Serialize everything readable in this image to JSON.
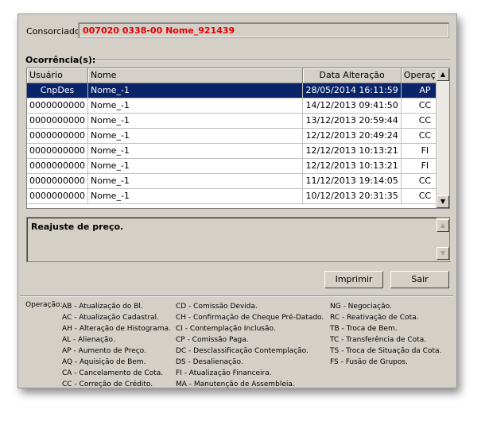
{
  "consorciado": {
    "label": "Consorciado:",
    "value": "007020 0338-00 Nome_921439"
  },
  "ocorrencias": {
    "title": "Ocorrência(s):"
  },
  "grid": {
    "headers": [
      "Usuário",
      "Nome",
      "Data Alteração",
      "Operação"
    ],
    "rows": [
      [
        "CnpDes",
        "Nome_-1",
        "28/05/2014 16:11:59",
        "AP"
      ],
      [
        "0000000000",
        "Nome_-1",
        "14/12/2013 09:41:50",
        "CC"
      ],
      [
        "0000000000",
        "Nome_-1",
        "13/12/2013 20:59:44",
        "CC"
      ],
      [
        "0000000000",
        "Nome_-1",
        "12/12/2013 20:49:24",
        "CC"
      ],
      [
        "0000000000",
        "Nome_-1",
        "12/12/2013 10:13:21",
        "FI"
      ],
      [
        "0000000000",
        "Nome_-1",
        "12/12/2013 10:13:21",
        "FI"
      ],
      [
        "0000000000",
        "Nome_-1",
        "11/12/2013 19:14:05",
        "CC"
      ],
      [
        "0000000000",
        "Nome_-1",
        "10/12/2013 20:31:35",
        "CC"
      ]
    ],
    "selected_row": 0
  },
  "memo": {
    "text": "Reajuste de preço."
  },
  "buttons": {
    "print": "Imprimir",
    "exit": "Sair"
  },
  "legend": {
    "label": "Operação:",
    "col1": [
      "AB - Atualização do Bl.",
      "AC - Atualização Cadastral.",
      "AH - Alteração de Histograma.",
      "AL - Alienação.",
      "AP - Aumento de Preço.",
      "AQ - Aquisição de Bem.",
      "CA - Cancelamento de Cota.",
      "CC - Correção de Crédito."
    ],
    "col2": [
      "CD - Comissão Devida.",
      "CH - Confirmação de Cheque Pré-Datado.",
      "CI - Contemplação Inclusão.",
      "CP - Comissão Paga.",
      "DC - Desclassificação Contemplação.",
      "DS - Desalienação.",
      "FI - Atualização Financeira.",
      "MA - Manutenção de Assembleia."
    ],
    "col3": [
      "NG - Negociação.",
      "RC - Reativação de Cota.",
      "TB - Troca de Bem.",
      "TC - Transferência de Cota.",
      "TS - Troca de Situação da Cota.",
      "FS - Fusão de Grupos."
    ]
  },
  "colors": {
    "selection": "#0a246a",
    "consorciado_value": "#e00000",
    "window_bg": "#d4d0c8"
  }
}
